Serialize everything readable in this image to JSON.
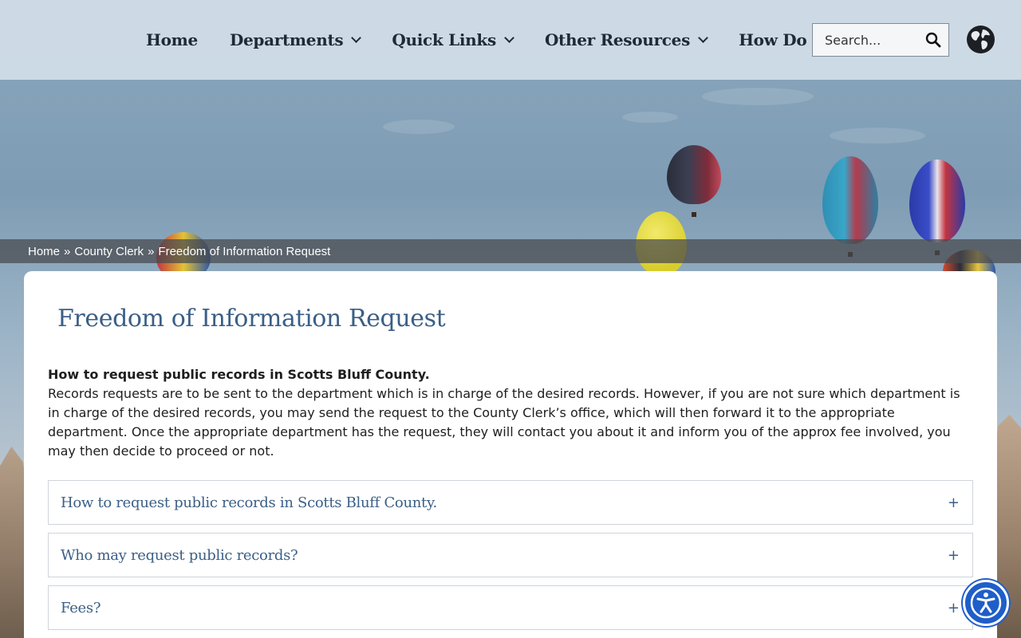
{
  "nav": {
    "items": [
      {
        "label": "Home",
        "has_dropdown": false
      },
      {
        "label": "Departments",
        "has_dropdown": true
      },
      {
        "label": "Quick Links",
        "has_dropdown": true
      },
      {
        "label": "Other Resources",
        "has_dropdown": true
      },
      {
        "label": "How Do I",
        "has_dropdown": true
      }
    ]
  },
  "search": {
    "placeholder": "Search...",
    "icon": "search-icon"
  },
  "language": {
    "icon": "globe-icon"
  },
  "breadcrumb": {
    "home": "Home",
    "separator": "»",
    "parent": "County Clerk",
    "current": "Freedom of Information Request"
  },
  "page": {
    "title": "Freedom of Information Request",
    "intro_heading": "How to request public records in Scotts Bluff County.",
    "intro_body": "Records requests are to be sent to the department which is in charge of the desired records. However, if you are not sure which department is in charge of the desired records, you may send the request to the County Clerk’s office, which will then forward it to the appropriate department. Once the appropriate department has the request, they will contact you about it and inform you of the approx fee involved, you may then decide to proceed or not."
  },
  "accordion": {
    "toggle_symbol": "+",
    "items": [
      {
        "label": "How to request public records in Scotts Bluff County."
      },
      {
        "label": "Who may request public records?"
      },
      {
        "label": "Fees?"
      }
    ]
  },
  "accessibility": {
    "icon": "accessibility-icon",
    "color": "#1f5ec9"
  },
  "colors": {
    "title": "#3b5f86",
    "header_bg": "#d2dee8",
    "breadcrumb_bg": "#46484c"
  }
}
